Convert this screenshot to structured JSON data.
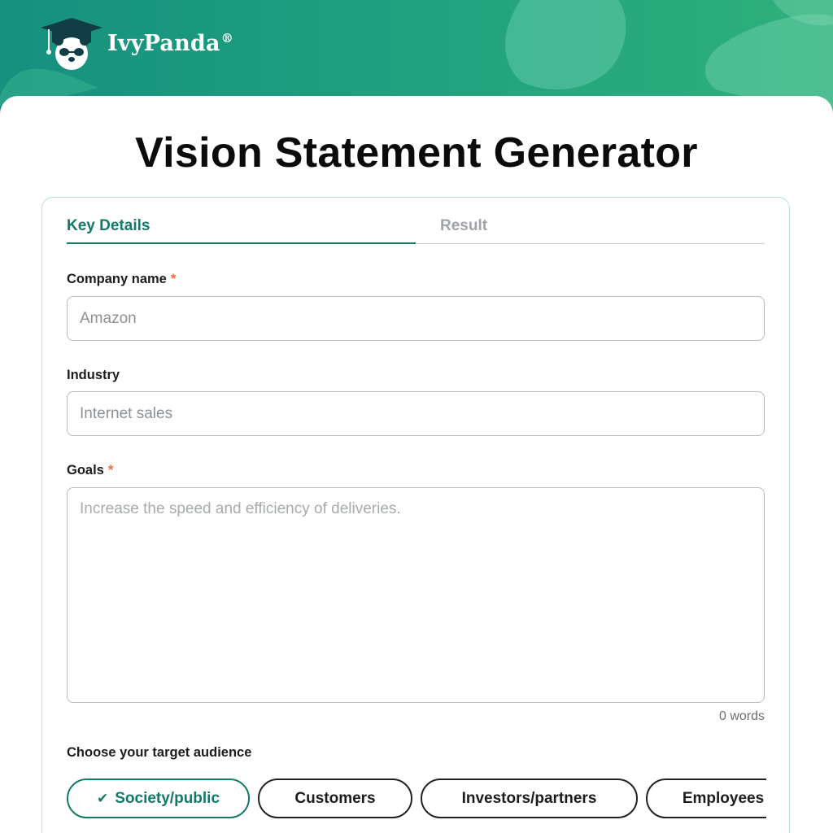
{
  "brand": {
    "name": "IvyPanda",
    "reg": "®"
  },
  "page_title": "Vision Statement Generator",
  "tabs": [
    {
      "label": "Key Details",
      "active": true
    },
    {
      "label": "Result",
      "active": false
    }
  ],
  "form": {
    "company": {
      "label": "Company name",
      "required_mark": "*",
      "value": "",
      "placeholder": "Amazon"
    },
    "industry": {
      "label": "Industry",
      "value": "",
      "placeholder": "Internet sales"
    },
    "goals": {
      "label": "Goals",
      "required_mark": "*",
      "value": "",
      "placeholder": "Increase the speed and efficiency of deliveries.",
      "word_count": "0 words"
    }
  },
  "audience": {
    "label": "Choose your target audience",
    "options": [
      {
        "label": "Society/public",
        "selected": true
      },
      {
        "label": "Customers",
        "selected": false
      },
      {
        "label": "Investors/partners",
        "selected": false
      },
      {
        "label": "Employees",
        "selected": false
      }
    ]
  },
  "colors": {
    "accent": "#127a67",
    "required": "#ef6b3c",
    "header_start": "#16907f",
    "header_end": "#2fb07c"
  },
  "icons": {
    "logo": "panda-graduation-cap-icon",
    "selected_chip": "checkmark-icon"
  }
}
